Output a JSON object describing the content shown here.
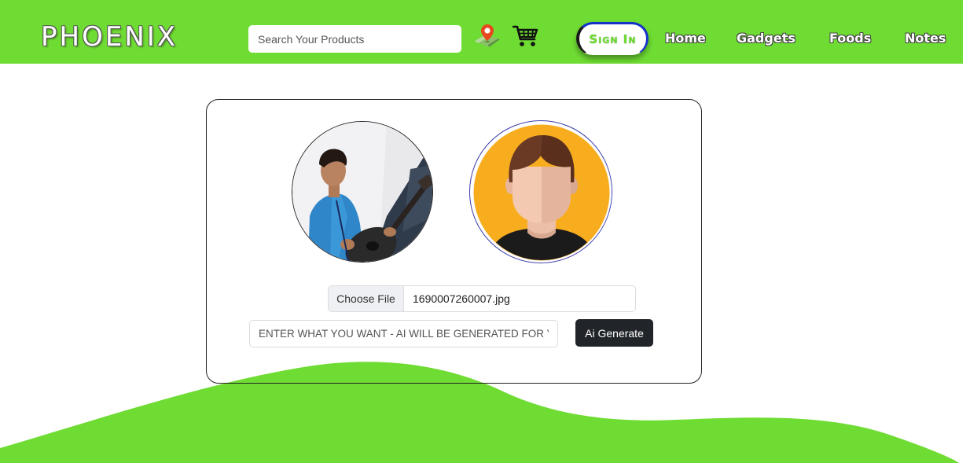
{
  "header": {
    "brand": "PHOENIX",
    "search_placeholder": "Search Your Products",
    "location_icon": "location-pin-icon",
    "cart_icon": "shopping-cart-icon",
    "sign_in_label": "Sign in",
    "nav": [
      "Home",
      "Gadgets",
      "Foods",
      "Notes"
    ]
  },
  "profile_card": {
    "uploaded_photo": "user-photo-with-guitar",
    "generated_avatar": "default-avatar-icon",
    "choose_file_label": "Choose File",
    "file_name": "1690007260007.jpg",
    "prompt_placeholder": "ENTER WHAT YOU WANT - AI WILL BE GENERATED FOR YOU",
    "generate_label": "Ai Generate"
  },
  "colors": {
    "brand_green": "#6fdc33",
    "dark_button": "#212529",
    "avatar_orange": "#f8ad1f",
    "signin_border_blue": "#1533c9"
  }
}
